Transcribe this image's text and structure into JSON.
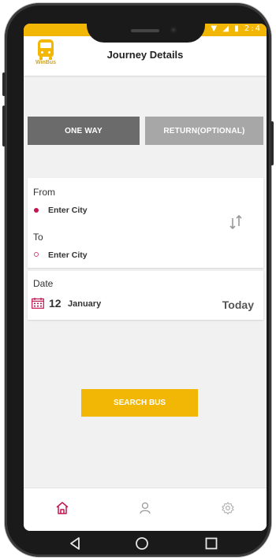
{
  "status_bar": {
    "icons": [
      "wifi-icon",
      "signal-icon",
      "battery-icon"
    ],
    "time": "2:4"
  },
  "app_bar": {
    "brand_name": "WinBus",
    "title": "Journey Details"
  },
  "trip_type": {
    "one_way_label": "ONE WAY",
    "return_label": "RETURN(OPTIONAL)",
    "selected": "ONE WAY"
  },
  "route": {
    "from_label": "From",
    "from_placeholder": "Enter City",
    "to_label": "To",
    "to_placeholder": "Enter City"
  },
  "date": {
    "label": "Date",
    "day": "12",
    "month": "January",
    "relative": "Today"
  },
  "search_button_label": "SEARCH BUS",
  "bottom_nav": {
    "items": [
      "home-icon",
      "profile-icon",
      "settings-icon"
    ],
    "active": "home-icon"
  },
  "system_nav": [
    "back-icon",
    "home-circle-icon",
    "recents-icon"
  ],
  "colors": {
    "accent": "#f2b705",
    "active_icon": "#c4154e",
    "one_way_bg": "#6b6b6b",
    "return_bg": "#a7a7a7"
  }
}
